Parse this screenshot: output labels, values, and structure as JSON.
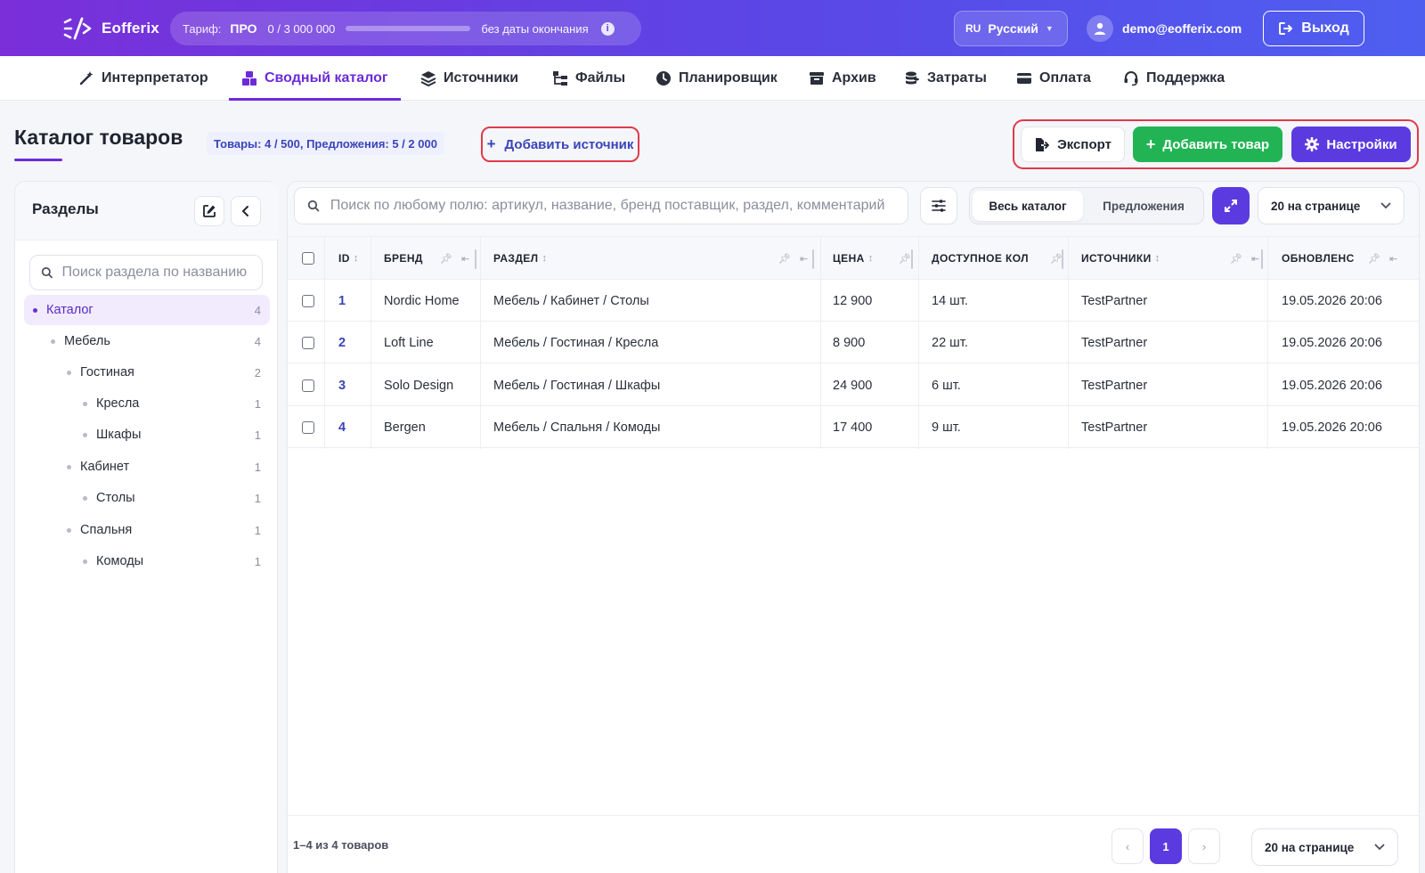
{
  "header": {
    "logo_text": "Eofferix",
    "tariff": {
      "label": "Тариф:",
      "plan": "ПРО",
      "usage": "0 / 3 000 000",
      "usage_fraction": 0,
      "expiry": "без даты окончания"
    },
    "language": {
      "code": "RU",
      "name": "Русский"
    },
    "user_email": "demo@eofferix.com",
    "logout_label": "Выход"
  },
  "nav": {
    "items": [
      {
        "label": "Интерпретатор",
        "icon": "magic-wand-icon"
      },
      {
        "label": "Сводный каталог",
        "icon": "boxes-icon",
        "active": true
      },
      {
        "label": "Источники",
        "icon": "layers-icon"
      },
      {
        "label": "Файлы",
        "icon": "folder-tree-icon"
      },
      {
        "label": "Планировщик",
        "icon": "clock-icon"
      },
      {
        "label": "Архив",
        "icon": "archive-icon"
      },
      {
        "label": "Затраты",
        "icon": "coins-icon"
      },
      {
        "label": "Оплата",
        "icon": "credit-card-icon"
      },
      {
        "label": "Поддержка",
        "icon": "headset-icon"
      }
    ]
  },
  "page": {
    "title": "Каталог товаров",
    "quota": "Товары: 4 / 500, Предложения: 5 / 2 000",
    "add_source_label": "Добавить источник",
    "export_label": "Экспорт",
    "add_product_label": "Добавить товар",
    "settings_label": "Настройки"
  },
  "sidebar": {
    "title": "Разделы",
    "search_placeholder": "Поиск раздела по названию",
    "tree": [
      {
        "label": "Каталог",
        "count": "4",
        "level": 0,
        "active": true
      },
      {
        "label": "Мебель",
        "count": "4",
        "level": 1
      },
      {
        "label": "Гостиная",
        "count": "2",
        "level": 2
      },
      {
        "label": "Кресла",
        "count": "1",
        "level": 3
      },
      {
        "label": "Шкафы",
        "count": "1",
        "level": 3
      },
      {
        "label": "Кабинет",
        "count": "1",
        "level": 2
      },
      {
        "label": "Столы",
        "count": "1",
        "level": 3
      },
      {
        "label": "Спальня",
        "count": "1",
        "level": 2
      },
      {
        "label": "Комоды",
        "count": "1",
        "level": 3
      }
    ]
  },
  "toolbar": {
    "search_placeholder": "Поиск по любому полю: артикул, название, бренд поставщик, раздел, комментарий",
    "view_all": "Весь каталог",
    "view_offers": "Предложения",
    "per_page": "20 на странице"
  },
  "table": {
    "columns": [
      "ID",
      "БРЕНД",
      "РАЗДЕЛ",
      "ЦЕНА",
      "ДОСТУПНОЕ КОЛ",
      "ИСТОЧНИКИ",
      "ОБНОВЛЕНС"
    ],
    "rows": [
      {
        "id": "1",
        "brand": "Nordic Home",
        "section": "Мебель / Кабинет / Столы",
        "price": "12 900",
        "qty": "14 шт.",
        "source": "TestPartner",
        "updated": "19.05.2026 20:06"
      },
      {
        "id": "2",
        "brand": "Loft Line",
        "section": "Мебель / Гостиная / Кресла",
        "price": "8 900",
        "qty": "22 шт.",
        "source": "TestPartner",
        "updated": "19.05.2026 20:06"
      },
      {
        "id": "3",
        "brand": "Solo Design",
        "section": "Мебель / Гостиная / Шкафы",
        "price": "24 900",
        "qty": "6 шт.",
        "source": "TestPartner",
        "updated": "19.05.2026 20:06"
      },
      {
        "id": "4",
        "brand": "Bergen",
        "section": "Мебель / Спальня / Комоды",
        "price": "17 400",
        "qty": "9 шт.",
        "source": "TestPartner",
        "updated": "19.05.2026 20:06"
      }
    ]
  },
  "footer": {
    "count": "1–4 из 4 товаров",
    "prev": "‹",
    "current_page": "1",
    "next": "›",
    "per_page": "20 на странице"
  },
  "colors": {
    "brand_purple": "#6c2bd9",
    "accent_indigo": "#5b3be0",
    "success_green": "#22b454",
    "highlight_red": "#e03a4a"
  }
}
